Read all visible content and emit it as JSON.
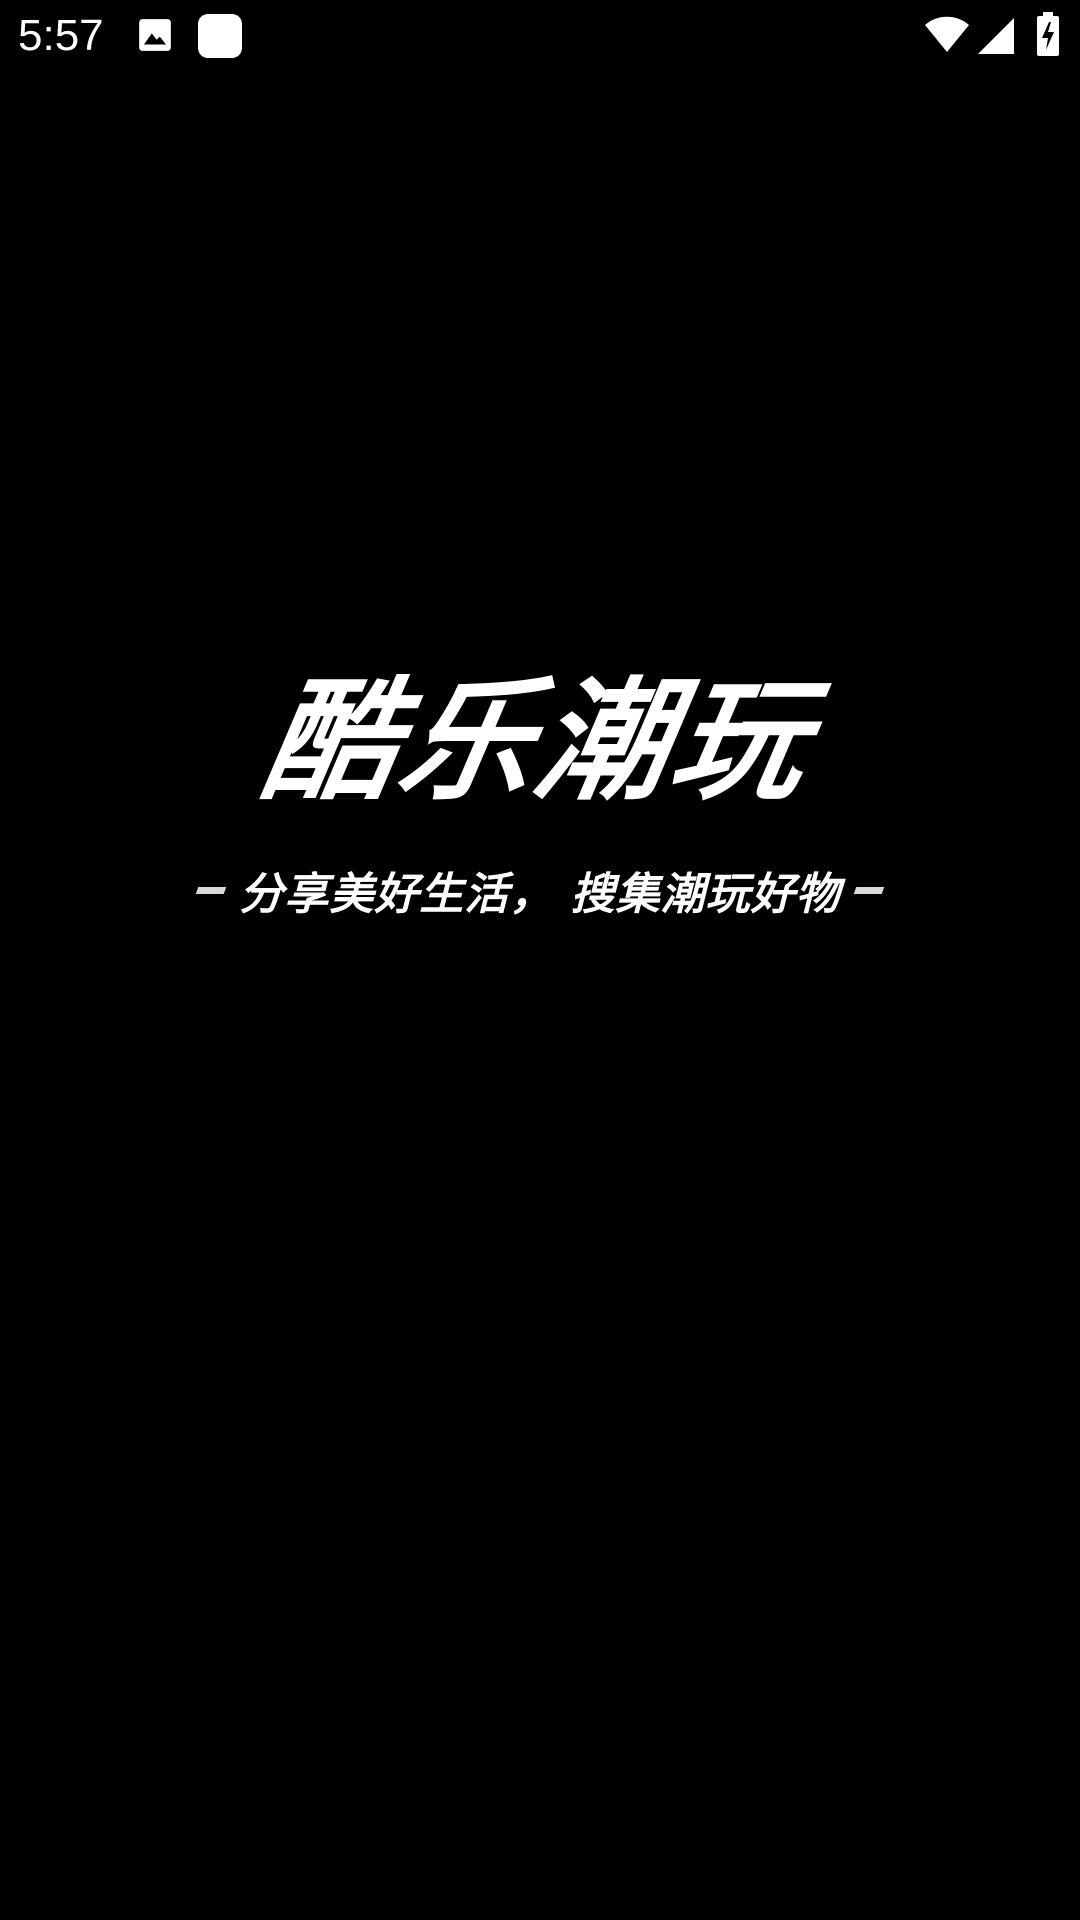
{
  "status_bar": {
    "time": "5:57",
    "icons": [
      "image-icon",
      "app-notification-icon",
      "wifi-icon",
      "cell-signal-icon",
      "battery-charging-icon"
    ]
  },
  "splash": {
    "logo_text": "酷乐潮玩",
    "slogan": "分享美好生活， 搜集潮玩好物"
  },
  "colors": {
    "background": "#000000",
    "foreground": "#ffffff"
  }
}
